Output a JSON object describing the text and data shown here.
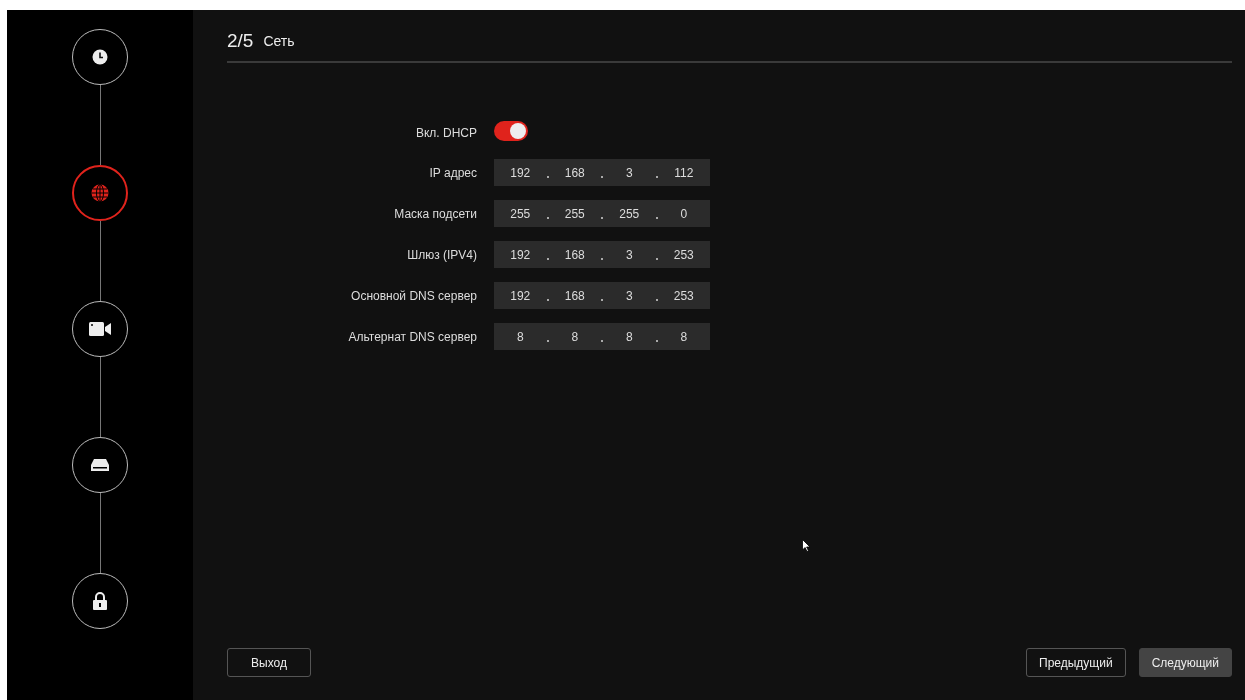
{
  "steps": [
    {
      "kind": "clock",
      "selected": false
    },
    {
      "kind": "globe",
      "selected": true
    },
    {
      "kind": "camera",
      "selected": false
    },
    {
      "kind": "drive",
      "selected": false
    },
    {
      "kind": "lock",
      "selected": false
    }
  ],
  "header": {
    "step": "2/5",
    "title": "Сеть"
  },
  "dhcp": {
    "label": "Вкл. DHCP",
    "on": true
  },
  "fields": [
    {
      "label": "IP адрес",
      "octets": [
        "192",
        "168",
        "3",
        "112"
      ]
    },
    {
      "label": "Маска подсети",
      "octets": [
        "255",
        "255",
        "255",
        "0"
      ]
    },
    {
      "label": "Шлюз (IPV4)",
      "octets": [
        "192",
        "168",
        "3",
        "253"
      ]
    },
    {
      "label": "Основной DNS сервер",
      "octets": [
        "192",
        "168",
        "3",
        "253"
      ]
    },
    {
      "label": "Альтернат DNS сервер",
      "octets": [
        "8",
        "8",
        "8",
        "8"
      ]
    }
  ],
  "buttons": [
    {
      "label": "Выход",
      "kind": "outline"
    },
    {
      "label": "Предыдущий",
      "kind": "outline"
    },
    {
      "label": "Следующий",
      "kind": "filled"
    }
  ]
}
